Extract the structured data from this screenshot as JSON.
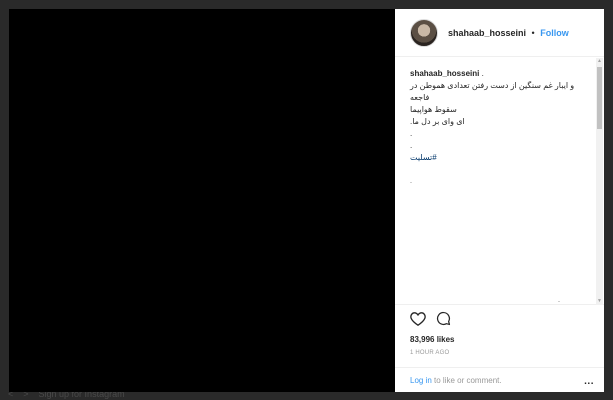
{
  "post": {
    "username": "shahaab_hosseini",
    "separator": "•",
    "follow_label": "Follow",
    "caption_user": "shahaab_hosseini",
    "caption_suffix": " .",
    "caption_lines": [
      "و ايبار غم سنگين از دست رفتن تعدادی هموطن در فاجعه",
      "سقوط هواپيما",
      "ای وای بر دل ما.",
      ".",
      "."
    ],
    "hashtag": "#تسليت",
    "likes": "83,996 likes",
    "time": "1 HOUR AGO"
  },
  "footer": {
    "login_label": "Log in",
    "login_suffix": " to like or comment.",
    "more_label": "..."
  },
  "background": {
    "strip_text": "Sign up for Instagram"
  },
  "icons": {
    "like": "heart-icon",
    "comment": "comment-icon",
    "more": "more-options-icon"
  },
  "colors": {
    "link_blue": "#3897f0",
    "hashtag_blue": "#003569",
    "media_bg": "#000000",
    "overlay_bg": "#2a2a2a"
  }
}
